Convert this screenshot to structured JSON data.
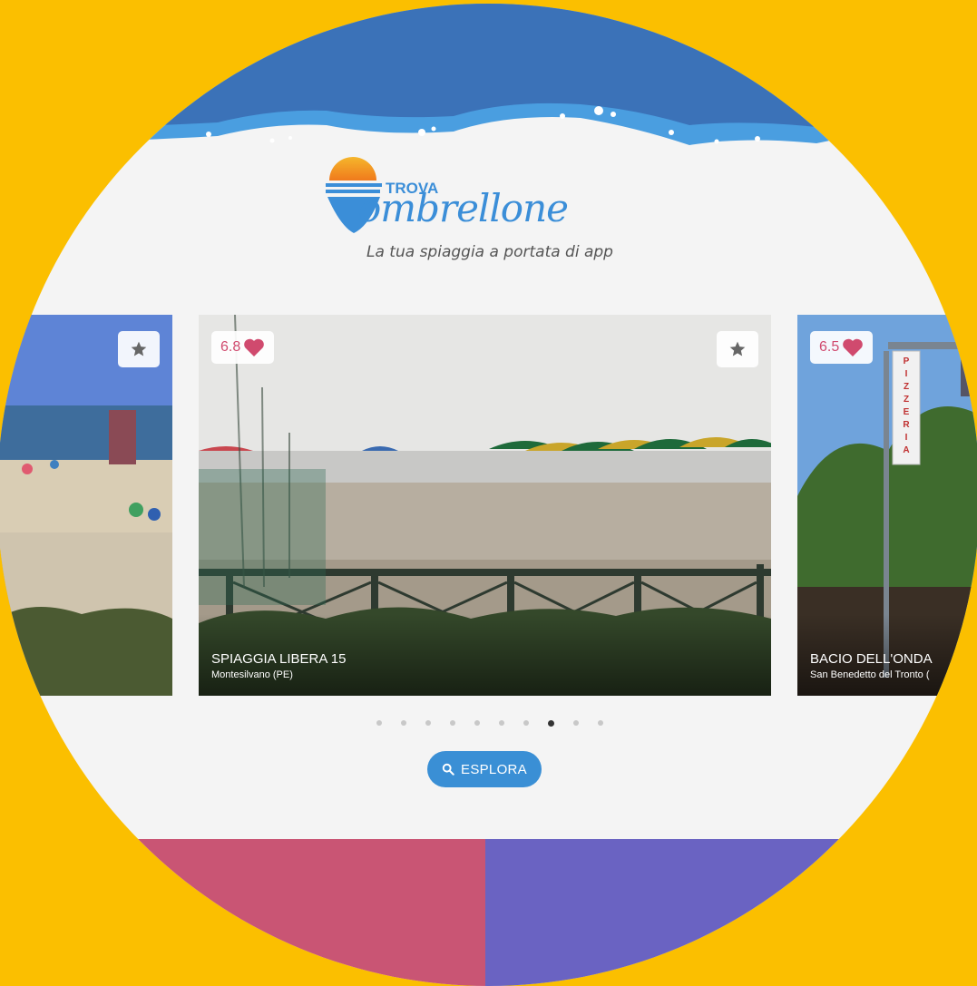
{
  "brand": {
    "name_small": "TROVA",
    "name_script": "ombrellone",
    "tagline": "La tua spiaggia a portata di app"
  },
  "cards": [
    {
      "title": "",
      "subtitle": "",
      "rating": "",
      "favorite_icon": "star-icon"
    },
    {
      "title": "SPIAGGIA LIBERA 15",
      "subtitle": "Montesilvano (PE)",
      "rating": "6.8",
      "rating_icon": "heart-icon",
      "favorite_icon": "star-icon"
    },
    {
      "title": "BACIO DELL'ONDA",
      "subtitle": "San Benedetto del Tronto (",
      "rating": "6.5",
      "rating_icon": "heart-icon"
    }
  ],
  "carousel": {
    "total_pages": 10,
    "active_page": 8
  },
  "explore_button": {
    "label": "ESPLORA",
    "icon": "search-icon"
  },
  "colors": {
    "background": "#fbbf00",
    "wave_dark": "#3b72b8",
    "wave_light": "#4a9ee0",
    "rating_text": "#d04a6e",
    "button": "#3a8fd5",
    "band_left": "#c95574",
    "band_right": "#6a63c2"
  }
}
